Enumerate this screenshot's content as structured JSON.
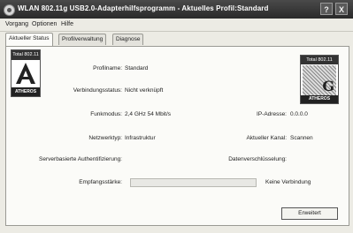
{
  "window": {
    "title": "WLAN 802.11g USB2.0-Adapterhilfsprogramm - Aktuelles Profil:Standard",
    "help_button": "?",
    "close_button": "X"
  },
  "menu": [
    {
      "label": "Vorgang"
    },
    {
      "label": "Optionen"
    },
    {
      "label": "Hilfe"
    }
  ],
  "tabs": [
    {
      "label": "Aktueller Status",
      "active": true
    },
    {
      "label": "Profilverwaltung",
      "active": false
    },
    {
      "label": "Diagnose",
      "active": false
    }
  ],
  "logos": {
    "left": {
      "badge": "Total 802.11",
      "brand": "ATHEROS",
      "letter": "A"
    },
    "right": {
      "badge": "Total 802.11",
      "brand": "ATHEROS",
      "letter": "G"
    }
  },
  "status": {
    "profile_name_label": "Profilname:",
    "profile_name_value": "Standard",
    "connection_status_label": "Verbindungsstatus:",
    "connection_status_value": "Nicht verknüpft",
    "radio_mode_label": "Funkmodus:",
    "radio_mode_value": "2,4 GHz 54 Mbit/s",
    "ip_label": "IP-Adresse:",
    "ip_value": "0.0.0.0",
    "network_type_label": "Netzwerktyp:",
    "network_type_value": "Infrastruktur",
    "channel_label": "Aktueller Kanal:",
    "channel_value": "Scannen",
    "server_auth_label": "Serverbasierte Authentifizierung:",
    "server_auth_value": "",
    "encryption_label": "Datenverschlüsselung:",
    "encryption_value": "",
    "signal_label": "Empfangsstärke:",
    "signal_fraction": 0,
    "signal_text": "Keine Verbindung"
  },
  "buttons": {
    "advanced": "Erweitert"
  }
}
